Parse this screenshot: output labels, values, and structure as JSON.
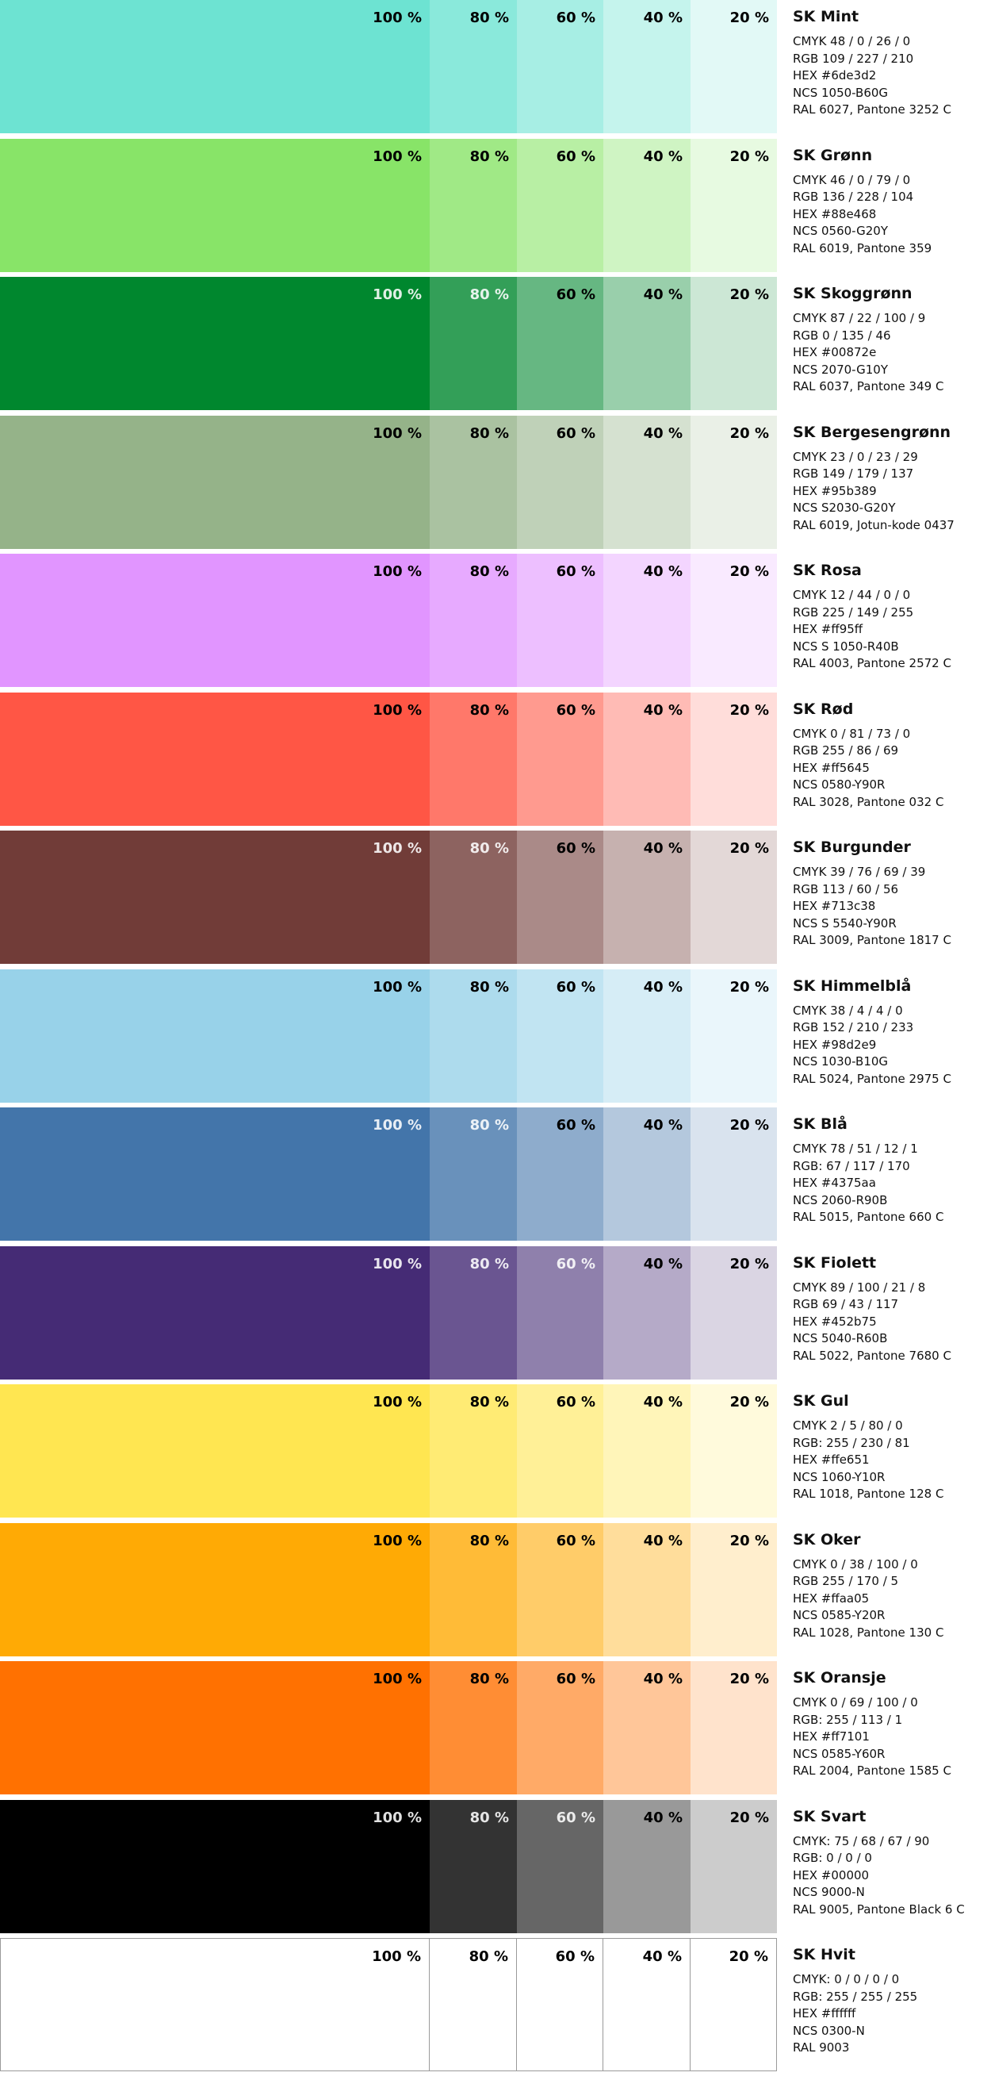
{
  "colors": [
    {
      "name": "SK Mint",
      "hex": "#6de3d2",
      "lines": [
        "CMYK 48 / 0 / 26 / 0",
        "RGB 109 / 227 / 210",
        "HEX #6de3d2",
        "NCS 1050-B60G",
        "RAL 6027, Pantone 3252 C"
      ],
      "label_colors": [
        "#000",
        "#000",
        "#000",
        "#000",
        "#000"
      ]
    },
    {
      "name": "SK Grønn",
      "hex": "#88e468",
      "lines": [
        "CMYK 46 / 0 / 79 / 0",
        "RGB 136 / 228 / 104",
        "HEX #88e468",
        "NCS 0560-G20Y",
        "RAL 6019, Pantone 359"
      ],
      "label_colors": [
        "#000",
        "#000",
        "#000",
        "#000",
        "#000"
      ]
    },
    {
      "name": "SK Skoggrønn",
      "hex": "#00872e",
      "lines": [
        "CMYK  87 / 22 / 100 / 9",
        "RGB 0 / 135 / 46",
        "HEX #00872e",
        "NCS 2070-G10Y",
        "RAL 6037, Pantone 349 C"
      ],
      "label_colors": [
        "#fff",
        "#fff",
        "#000",
        "#000",
        "#000"
      ]
    },
    {
      "name": "SK Bergesengrønn",
      "hex": "#95b389",
      "lines": [
        "CMYK 23 / 0 / 23 / 29",
        "RGB 149 / 179 / 137",
        "HEX #95b389",
        "NCS S2030-G20Y",
        "RAL 6019, Jotun-kode 0437"
      ],
      "label_colors": [
        "#000",
        "#000",
        "#000",
        "#000",
        "#000"
      ]
    },
    {
      "name": "SK Rosa",
      "hex": "#e195ff",
      "lines": [
        "CMYK 12 / 44 / 0 / 0",
        "RGB 225 / 149 / 255",
        "HEX #ff95ff",
        "NCS S 1050-R40B",
        "RAL 4003, Pantone 2572 C"
      ],
      "label_colors": [
        "#000",
        "#000",
        "#000",
        "#000",
        "#000"
      ]
    },
    {
      "name": "SK Rød",
      "hex": "#ff5645",
      "lines": [
        "CMYK 0 / 81 / 73 / 0",
        "RGB 255 / 86 / 69",
        "HEX #ff5645",
        "NCS 0580-Y90R",
        "RAL 3028, Pantone 032 C"
      ],
      "label_colors": [
        "#000",
        "#000",
        "#000",
        "#000",
        "#000"
      ]
    },
    {
      "name": "SK Burgunder",
      "hex": "#713c38",
      "lines": [
        "CMYK 39 / 76 / 69 / 39",
        "RGB 113 / 60 / 56",
        "HEX #713c38",
        "NCS S 5540-Y90R",
        "RAL 3009, Pantone 1817 C"
      ],
      "label_colors": [
        "#fff",
        "#fff",
        "#000",
        "#000",
        "#000"
      ]
    },
    {
      "name": "SK Himmelblå",
      "hex": "#98d2e9",
      "lines": [
        "CMYK 38 / 4 / 4 / 0",
        "RGB 152 / 210 / 233",
        "HEX #98d2e9",
        "NCS 1030-B10G",
        "RAL 5024, Pantone 2975 C"
      ],
      "label_colors": [
        "#000",
        "#000",
        "#000",
        "#000",
        "#000"
      ]
    },
    {
      "name": "SK Blå",
      "hex": "#4375aa",
      "lines": [
        "CMYK 78 / 51 / 12 / 1",
        "RGB: 67 / 117 / 170",
        "HEX #4375aa",
        "NCS 2060-R90B",
        "RAL 5015, Pantone 660 C"
      ],
      "label_colors": [
        "#fff",
        "#fff",
        "#000",
        "#000",
        "#000"
      ]
    },
    {
      "name": "SK Fiolett",
      "hex": "#452b75",
      "lines": [
        "CMYK 89 / 100 / 21 / 8",
        "RGB 69 / 43 / 117",
        "HEX #452b75",
        "NCS 5040-R60B",
        "RAL 5022, Pantone 7680 C"
      ],
      "label_colors": [
        "#fff",
        "#fff",
        "#fff",
        "#000",
        "#000"
      ]
    },
    {
      "name": "SK Gul",
      "hex": "#ffe651",
      "lines": [
        "CMYK 2 / 5 / 80 / 0",
        "RGB: 255 / 230 / 81",
        "HEX #ffe651",
        "NCS 1060-Y10R",
        "RAL 1018, Pantone 128 C"
      ],
      "label_colors": [
        "#000",
        "#000",
        "#000",
        "#000",
        "#000"
      ]
    },
    {
      "name": "SK Oker",
      "hex": "#ffaa05",
      "lines": [
        "CMYK 0 / 38 / 100 / 0",
        "RGB 255 / 170 / 5",
        "HEX #ffaa05",
        "NCS 0585-Y20R",
        "RAL 1028, Pantone 130 C"
      ],
      "label_colors": [
        "#000",
        "#000",
        "#000",
        "#000",
        "#000"
      ]
    },
    {
      "name": "SK Oransje",
      "hex": "#ff7101",
      "lines": [
        "CMYK 0 / 69 / 100 / 0",
        "RGB: 255 / 113 / 1",
        "HEX #ff7101",
        "NCS 0585-Y60R",
        "RAL 2004, Pantone 1585 C"
      ],
      "label_colors": [
        "#000",
        "#000",
        "#000",
        "#000",
        "#000"
      ]
    },
    {
      "name": "SK Svart",
      "hex": "#000000",
      "lines": [
        "CMYK: 75 / 68 / 67 / 90",
        "RGB: 0 / 0 / 0",
        "HEX #00000",
        "NCS 9000-N",
        "RAL 9005, Pantone Black 6 C"
      ],
      "label_colors": [
        "#fff",
        "#fff",
        "#fff",
        "#000",
        "#000"
      ]
    },
    {
      "name": "SK Hvit",
      "hex": "#ffffff",
      "lines": [
        "CMYK: 0 / 0 / 0 / 0",
        "RGB: 255 / 255 / 255",
        "HEX #ffffff",
        "NCS 0300-N",
        "RAL 9003"
      ],
      "label_colors": [
        "#000",
        "#000",
        "#000",
        "#000",
        "#000"
      ],
      "outlined": true
    }
  ],
  "tint_levels": [
    1,
    0.8,
    0.6,
    0.4,
    0.2
  ],
  "tint_labels": [
    "100 %",
    "80 %",
    "60 %",
    "40 %",
    "20 %"
  ]
}
